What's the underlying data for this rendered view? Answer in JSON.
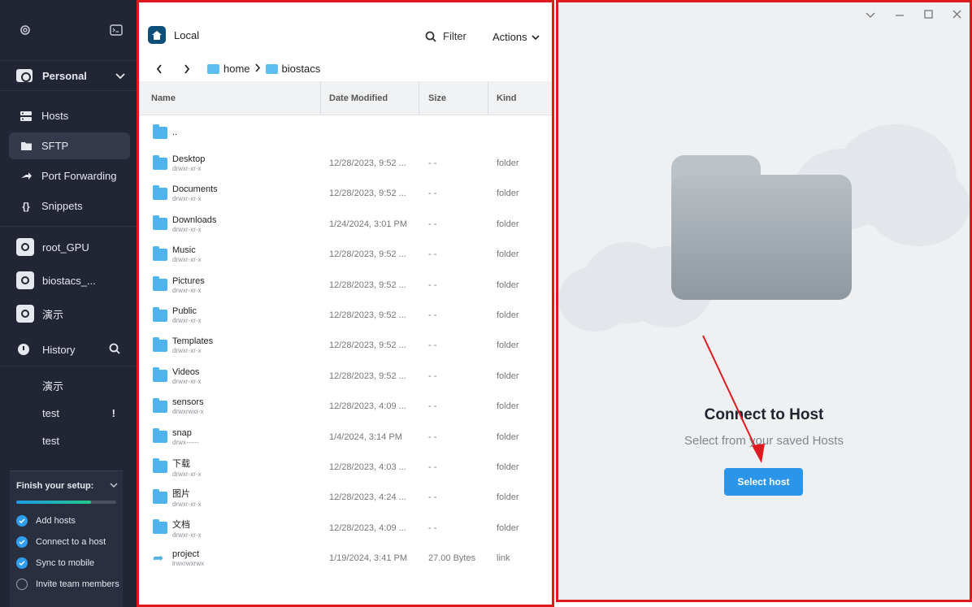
{
  "sidebar": {
    "vault_name": "Personal",
    "nav": [
      {
        "label": "Hosts",
        "icon": "hosts-icon"
      },
      {
        "label": "SFTP",
        "icon": "folder-icon",
        "active": true
      },
      {
        "label": "Port Forwarding",
        "icon": "port-forwarding-icon"
      },
      {
        "label": "Snippets",
        "icon": "snippets-icon"
      }
    ],
    "hosts": [
      {
        "label": "root_GPU"
      },
      {
        "label": "biostacs_..."
      },
      {
        "label": "演示"
      }
    ],
    "history_label": "History",
    "history": [
      {
        "label": "演示"
      },
      {
        "label": "test",
        "badge": "!"
      },
      {
        "label": "test"
      }
    ],
    "setup": {
      "title": "Finish your setup:",
      "progress": 0.75,
      "tasks": [
        {
          "label": "Add hosts",
          "done": true
        },
        {
          "label": "Connect to a host",
          "done": true
        },
        {
          "label": "Sync to mobile",
          "done": true
        },
        {
          "label": "Invite team members",
          "done": false
        }
      ]
    }
  },
  "local": {
    "title": "Local",
    "filter_label": "Filter",
    "actions_label": "Actions",
    "breadcrumb": [
      "home",
      "biostacs"
    ],
    "columns": [
      "Name",
      "Date Modified",
      "Size",
      "Kind"
    ],
    "rows": [
      {
        "name": "..",
        "perm": "",
        "date": "",
        "size": "",
        "kind": "",
        "type": "folder"
      },
      {
        "name": "Desktop",
        "perm": "drwxr-xr-x",
        "date": "12/28/2023, 9:52 ...",
        "size": "- -",
        "kind": "folder",
        "type": "folder"
      },
      {
        "name": "Documents",
        "perm": "drwxr-xr-x",
        "date": "12/28/2023, 9:52 ...",
        "size": "- -",
        "kind": "folder",
        "type": "folder"
      },
      {
        "name": "Downloads",
        "perm": "drwxr-xr-x",
        "date": "1/24/2024, 3:01 PM",
        "size": "- -",
        "kind": "folder",
        "type": "folder"
      },
      {
        "name": "Music",
        "perm": "drwxr-xr-x",
        "date": "12/28/2023, 9:52 ...",
        "size": "- -",
        "kind": "folder",
        "type": "folder"
      },
      {
        "name": "Pictures",
        "perm": "drwxr-xr-x",
        "date": "12/28/2023, 9:52 ...",
        "size": "- -",
        "kind": "folder",
        "type": "folder"
      },
      {
        "name": "Public",
        "perm": "drwxr-xr-x",
        "date": "12/28/2023, 9:52 ...",
        "size": "- -",
        "kind": "folder",
        "type": "folder"
      },
      {
        "name": "Templates",
        "perm": "drwxr-xr-x",
        "date": "12/28/2023, 9:52 ...",
        "size": "- -",
        "kind": "folder",
        "type": "folder"
      },
      {
        "name": "Videos",
        "perm": "drwxr-xr-x",
        "date": "12/28/2023, 9:52 ...",
        "size": "- -",
        "kind": "folder",
        "type": "folder"
      },
      {
        "name": "sensors",
        "perm": "drwxrwxr-x",
        "date": "12/28/2023, 4:09 ...",
        "size": "- -",
        "kind": "folder",
        "type": "folder"
      },
      {
        "name": "snap",
        "perm": "drwx------",
        "date": "1/4/2024, 3:14 PM",
        "size": "- -",
        "kind": "folder",
        "type": "folder"
      },
      {
        "name": "下载",
        "perm": "drwxr-xr-x",
        "date": "12/28/2023, 4:03 ...",
        "size": "- -",
        "kind": "folder",
        "type": "folder"
      },
      {
        "name": "图片",
        "perm": "drwxr-xr-x",
        "date": "12/28/2023, 4:24 ...",
        "size": "- -",
        "kind": "folder",
        "type": "folder"
      },
      {
        "name": "文档",
        "perm": "drwxr-xr-x",
        "date": "12/28/2023, 4:09 ...",
        "size": "- -",
        "kind": "folder",
        "type": "folder"
      },
      {
        "name": "project",
        "perm": "lrwxrwxrwx",
        "date": "1/19/2024, 3:41 PM",
        "size": "27.00 Bytes",
        "kind": "link",
        "type": "link"
      }
    ]
  },
  "remote": {
    "title": "Connect to Host",
    "subtitle": "Select from your saved Hosts",
    "button_label": "Select host"
  },
  "colors": {
    "sidebar_bg": "#212534",
    "accent": "#2b95ea",
    "annotation_red": "#e0191f",
    "folder_blue": "#4fb3ee"
  }
}
